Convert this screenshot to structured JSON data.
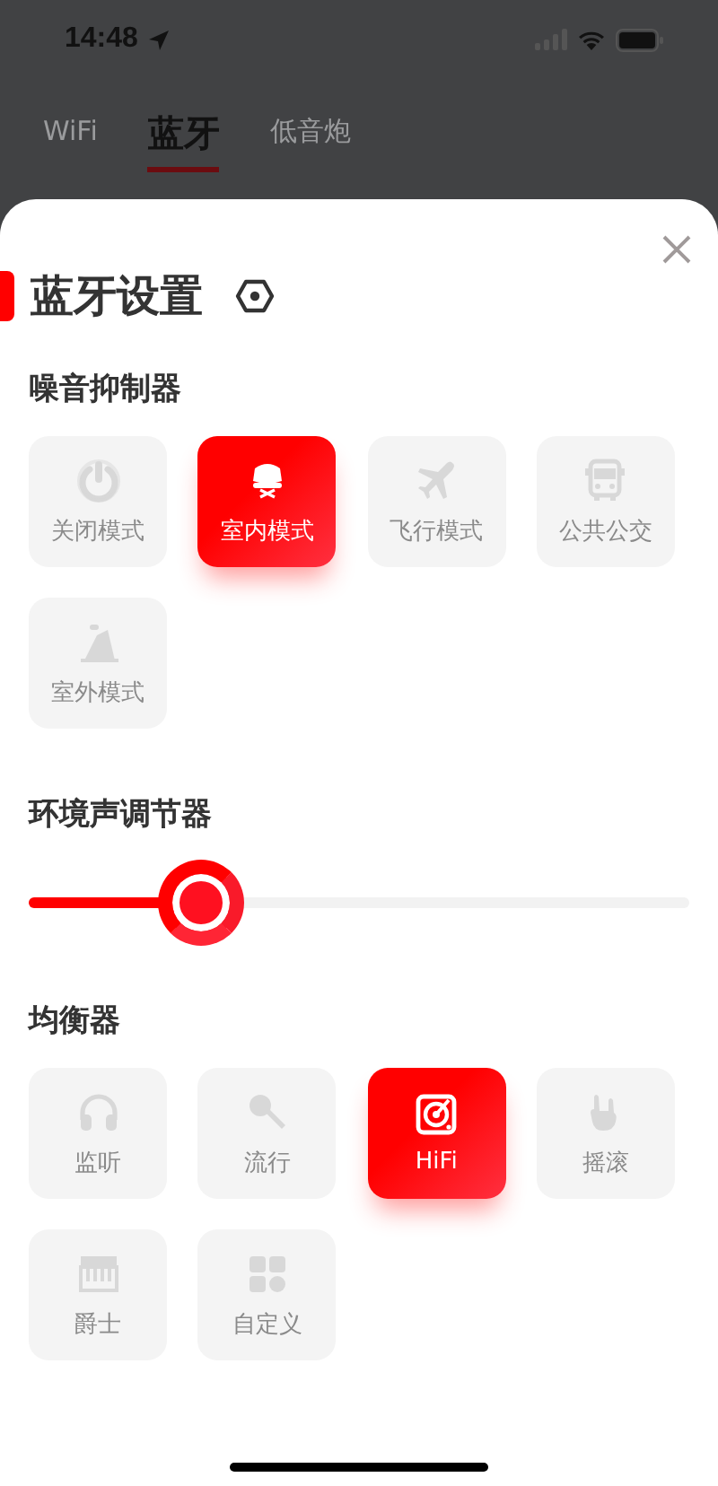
{
  "status_bar": {
    "time": "14:48"
  },
  "tabs": [
    {
      "label": "WiFi",
      "selected": false
    },
    {
      "label": "蓝牙",
      "selected": true
    },
    {
      "label": "低音炮",
      "selected": false
    }
  ],
  "sheet": {
    "title": "蓝牙设置",
    "noise_control": {
      "heading": "噪音抑制器",
      "modes": [
        {
          "label": "关闭模式",
          "selected": false
        },
        {
          "label": "室内模式",
          "selected": true
        },
        {
          "label": "飞行模式",
          "selected": false
        },
        {
          "label": "公共公交",
          "selected": false
        },
        {
          "label": "室外模式",
          "selected": false
        }
      ]
    },
    "ambient": {
      "heading": "环境声调节器",
      "level": 0.255
    },
    "equalizer": {
      "heading": "均衡器",
      "presets": [
        {
          "label": "监听",
          "selected": false
        },
        {
          "label": "流行",
          "selected": false
        },
        {
          "label": "HiFi",
          "selected": true
        },
        {
          "label": "摇滚",
          "selected": false
        },
        {
          "label": "爵士",
          "selected": false
        },
        {
          "label": "自定义",
          "selected": false
        }
      ]
    }
  }
}
